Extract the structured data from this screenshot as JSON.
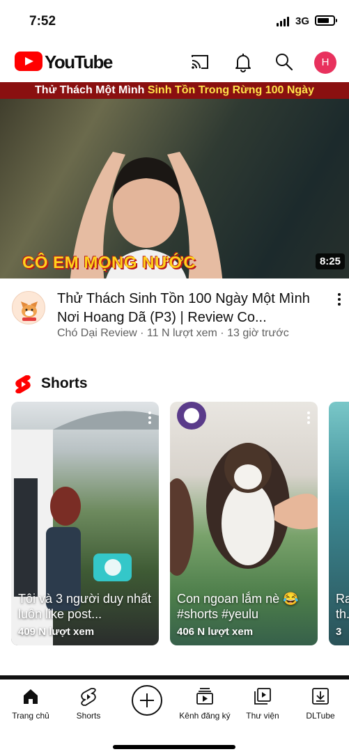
{
  "status_bar": {
    "time": "7:52",
    "network": "3G",
    "battery_level": 0.75
  },
  "header": {
    "brand": "YouTube",
    "avatar_initial": "H",
    "icons": [
      "cast-icon",
      "bell-icon",
      "search-icon"
    ]
  },
  "featured": {
    "banner_prefix": "Thử Thách Một Mình ",
    "banner_highlight": "Sinh Tồn Trong Rừng 100 Ngày",
    "thumb_caption": "CÔ EM MỌNG NƯỚC",
    "duration": "8:25",
    "title": "Thử Thách Sinh Tồn 100 Ngày Một Mình Nơi Hoang Dã (P3) | Review Co...",
    "subtitle": "Chó Dại Review · 11 N lượt xem · 13 giờ trước"
  },
  "shorts": {
    "section_title": "Shorts",
    "items": [
      {
        "title": "Tôi và 3 người duy nhất luôn like post...",
        "views": "409 N lượt xem"
      },
      {
        "title": "Con ngoan lắm nè 😂 #shorts #yeulu",
        "views": "406 N lượt xem"
      },
      {
        "title": "Ra th...",
        "views": "3"
      }
    ]
  },
  "bottom_nav": [
    {
      "label": "Trang chủ",
      "icon": "home-icon"
    },
    {
      "label": "Shorts",
      "icon": "shorts-icon"
    },
    {
      "label": "",
      "icon": "create-icon"
    },
    {
      "label": "Kênh đăng ký",
      "icon": "subscriptions-icon"
    },
    {
      "label": "Thư viện",
      "icon": "library-icon"
    },
    {
      "label": "DLTube",
      "icon": "download-icon"
    }
  ],
  "colors": {
    "brand_red": "#ff0000",
    "avatar_pink": "#e8315d",
    "meta_gray": "#606060"
  }
}
